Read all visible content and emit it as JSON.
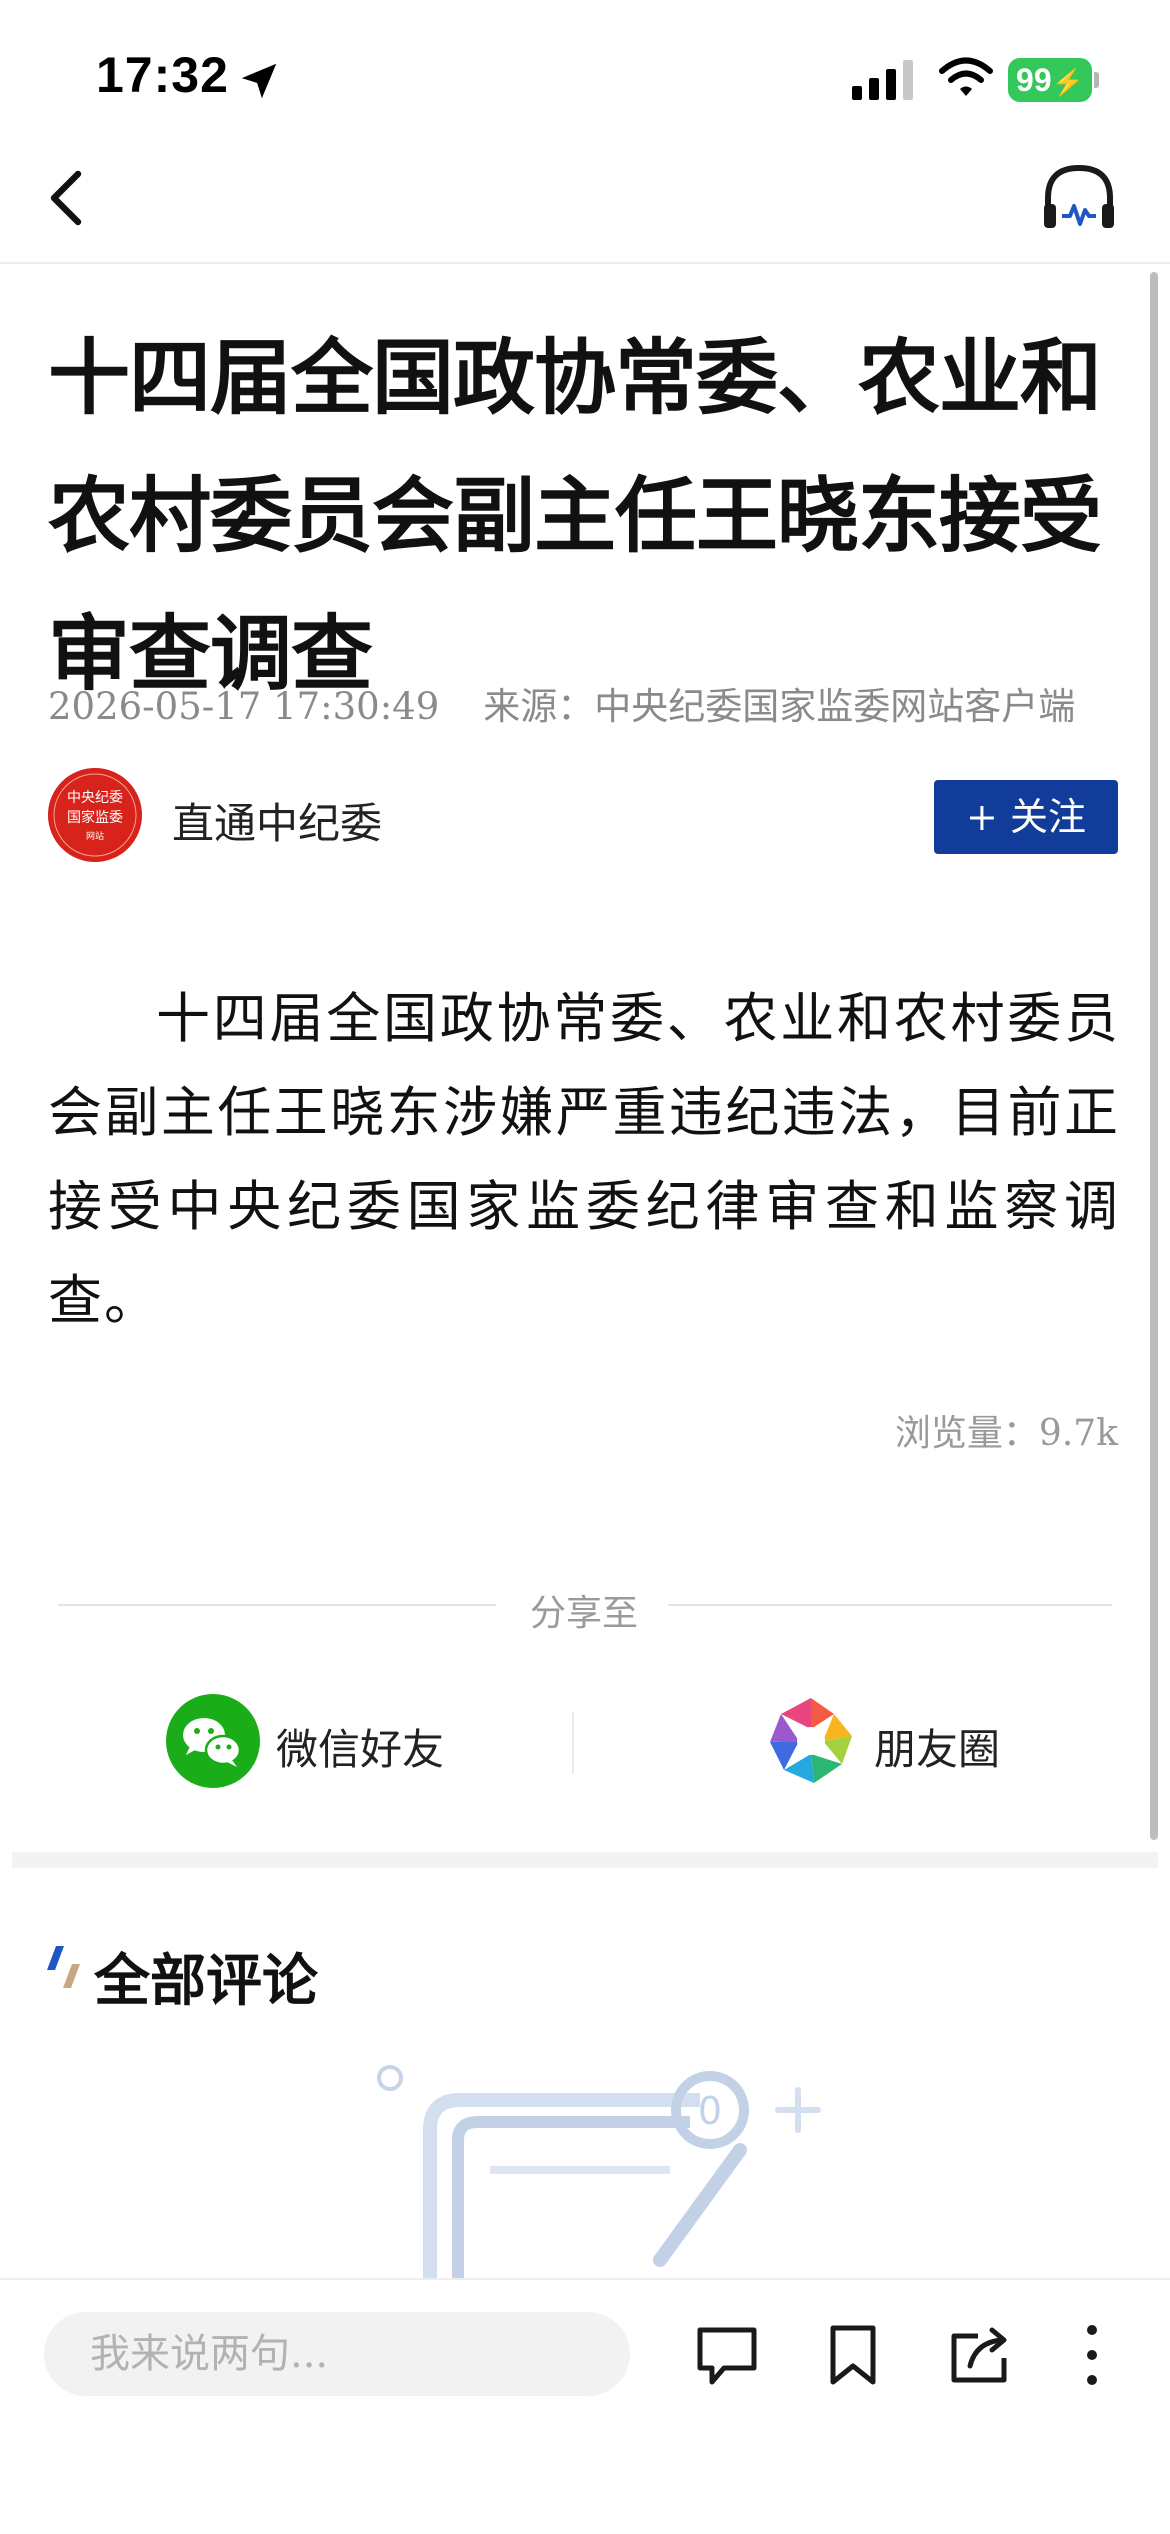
{
  "status_bar": {
    "time": "17:32",
    "battery": "99",
    "icons": [
      "location-arrow-icon",
      "signal-icon",
      "wifi-icon",
      "battery-icon"
    ]
  },
  "nav": {
    "back_icon": "chevron-left-icon",
    "listen_icon": "headphones-icon"
  },
  "article": {
    "title": "十四届全国政协常委、农业和农村委员会副主任王晓东接受审查调查",
    "date": "2026-05-17 17:30:49",
    "source": "来源：中央纪委国家监委网站客户端",
    "author": {
      "name": "直通中纪委",
      "avatar_text": [
        "中央纪委",
        "国家监委",
        "网站"
      ]
    },
    "follow_label": "+ 关注",
    "body": "十四届全国政协常委、农业和农村委员会副主任王晓东涉嫌严重违纪违法，目前正接受中央纪委国家监委纪律审查和监察调查。",
    "views": "浏览量：9.7k"
  },
  "share": {
    "label": "分享至",
    "wechat": "微信好友",
    "moments": "朋友圈"
  },
  "comments": {
    "title": "全部评论"
  },
  "bottom_bar": {
    "input_placeholder": "我来说两句...",
    "icons": [
      "comment-icon",
      "bookmark-icon",
      "share-icon",
      "more-icon"
    ]
  },
  "colors": {
    "follow_button": "#123c9a",
    "avatar": "#d8231b",
    "wechat_green": "#1aad19",
    "battery_green": "#34c759"
  }
}
